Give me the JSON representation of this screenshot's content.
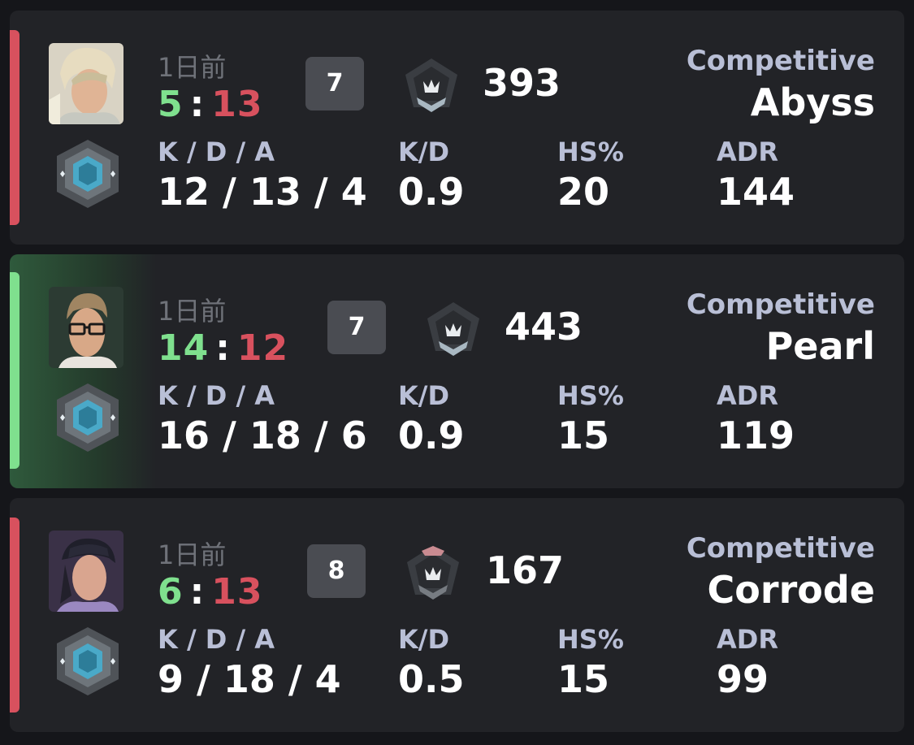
{
  "matches": [
    {
      "result": "loss",
      "time_ago": "1日前",
      "score_team": "5",
      "score_sep": ":",
      "score_enemy": "13",
      "placement": "7",
      "rr": "393",
      "mode": "Competitive",
      "map": "Abyss",
      "agent_icon": "agent-blonde-portrait",
      "kda_label": "K / D / A",
      "kda": "12 / 13 / 4",
      "kd_label": "K/D",
      "kd": "0.9",
      "hs_label": "HS%",
      "hs": "20",
      "adr_label": "ADR",
      "adr": "144"
    },
    {
      "result": "win",
      "time_ago": "1日前",
      "score_team": "14",
      "score_sep": ":",
      "score_enemy": "12",
      "placement": "7",
      "rr": "443",
      "mode": "Competitive",
      "map": "Pearl",
      "agent_icon": "agent-glasses-portrait",
      "kda_label": "K / D / A",
      "kda": "16 / 18 / 6",
      "kd_label": "K/D",
      "kd": "0.9",
      "hs_label": "HS%",
      "hs": "15",
      "adr_label": "ADR",
      "adr": "119"
    },
    {
      "result": "loss",
      "time_ago": "1日前",
      "score_team": "6",
      "score_sep": ":",
      "score_enemy": "13",
      "placement": "8",
      "rr": "167",
      "mode": "Competitive",
      "map": "Corrode",
      "agent_icon": "agent-cap-portrait",
      "kda_label": "K / D / A",
      "kda": "9 / 18 / 4",
      "kd_label": "K/D",
      "kd": "0.5",
      "hs_label": "HS%",
      "hs": "15",
      "adr_label": "ADR",
      "adr": "99"
    }
  ],
  "colors": {
    "win": "#7fe08e",
    "loss": "#d8515e",
    "label": "#b9bfd6",
    "muted": "#6f7279",
    "card": "#222327",
    "background": "#15161a"
  }
}
